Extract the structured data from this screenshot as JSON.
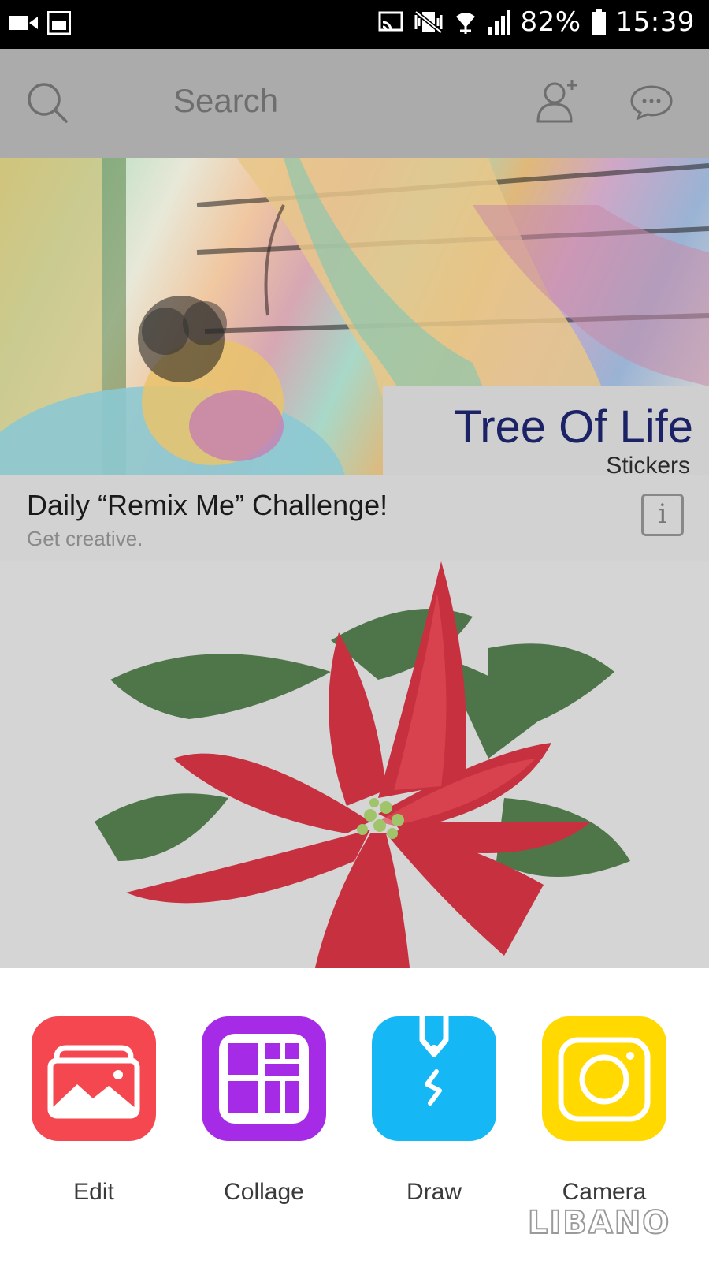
{
  "status_bar": {
    "battery": "82%",
    "time": "15:39",
    "icons": [
      "video-camera-icon",
      "gallery-icon",
      "cast-icon",
      "vibrate-mute-icon",
      "wifi-icon",
      "signal-icon",
      "battery-icon"
    ]
  },
  "header": {
    "search_placeholder": "Search",
    "icons": [
      "search-icon",
      "add-user-icon",
      "chat-icon"
    ]
  },
  "banner": {
    "title": "Tree Of Life",
    "subtitle": "Stickers"
  },
  "challenge": {
    "title": "Daily “Remix Me” Challenge!",
    "subtitle": "Get creative.",
    "info_glyph": "i"
  },
  "tools": [
    {
      "label": "Edit",
      "color": "#f5474f",
      "icon": "image-icon"
    },
    {
      "label": "Collage",
      "color": "#a62be6",
      "icon": "collage-grid-icon"
    },
    {
      "label": "Draw",
      "color": "#16b7f5",
      "icon": "pen-icon"
    },
    {
      "label": "Camera",
      "color": "#ffd900",
      "icon": "camera-icon"
    }
  ],
  "watermark": {
    "logo": "LIBANO"
  }
}
